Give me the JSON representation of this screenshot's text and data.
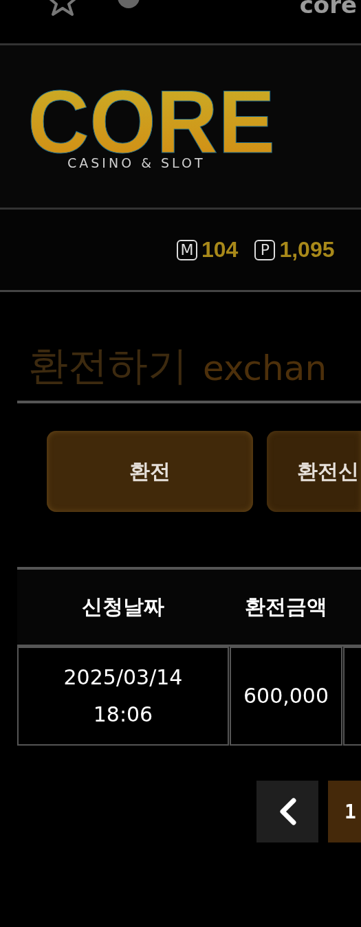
{
  "browser_bar": {
    "title": "core"
  },
  "logo": {
    "wordmark": "CORE",
    "tagline": "CASINO & SLOT"
  },
  "points": [
    {
      "badge": "M",
      "value": "104"
    },
    {
      "badge": "P",
      "value": "1,095"
    }
  ],
  "page_title": {
    "korean": "환전하기",
    "english": "exchan"
  },
  "tabs": [
    {
      "label": "환전",
      "selected": true
    },
    {
      "label": "환전신",
      "selected": false
    }
  ],
  "table": {
    "columns": [
      "신청날짜",
      "환전금액"
    ],
    "rows": [
      {
        "cells": [
          "2025/03/14\n18:06",
          "600,000"
        ]
      }
    ]
  },
  "pagination": {
    "pages": [
      {
        "label": "1",
        "selected": true
      }
    ]
  }
}
